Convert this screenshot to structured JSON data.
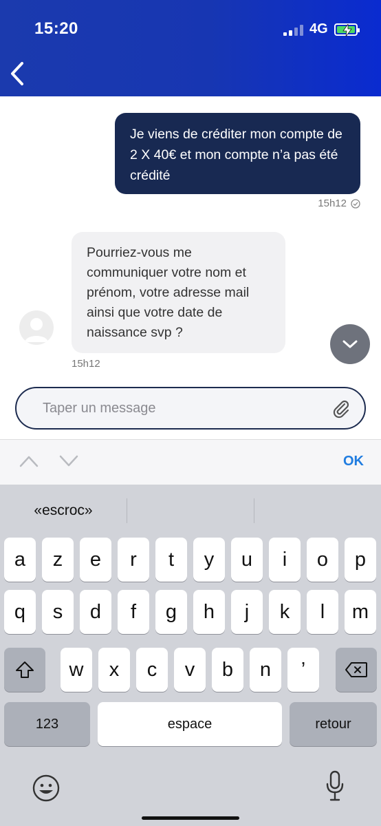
{
  "status_bar": {
    "time": "15:20",
    "network": "4G"
  },
  "conversation": {
    "outgoing": {
      "text": "Je viens de créditer mon compte de 2 X 40€ et mon compte n’a pas été crédité",
      "time": "15h12"
    },
    "incoming": {
      "text": "Pourriez-vous me communiquer votre nom et prénom, votre adresse mail ainsi que votre date de naissance svp ?",
      "time": "15h12"
    }
  },
  "composer": {
    "placeholder": "Taper un message"
  },
  "toolbar": {
    "ok_label": "OK"
  },
  "keyboard": {
    "suggestions": [
      "«escroc»",
      "",
      ""
    ],
    "row1": [
      "a",
      "z",
      "e",
      "r",
      "t",
      "y",
      "u",
      "i",
      "o",
      "p"
    ],
    "row2": [
      "q",
      "s",
      "d",
      "f",
      "g",
      "h",
      "j",
      "k",
      "l",
      "m"
    ],
    "row3": [
      "w",
      "x",
      "c",
      "v",
      "b",
      "n",
      "’"
    ],
    "numbers_label": "123",
    "space_label": "espace",
    "return_label": "retour"
  },
  "colors": {
    "header": "#1736B2",
    "outgoing_bubble": "#182952",
    "incoming_bubble": "#F1F1F3",
    "accent": "#1F7CE0"
  }
}
